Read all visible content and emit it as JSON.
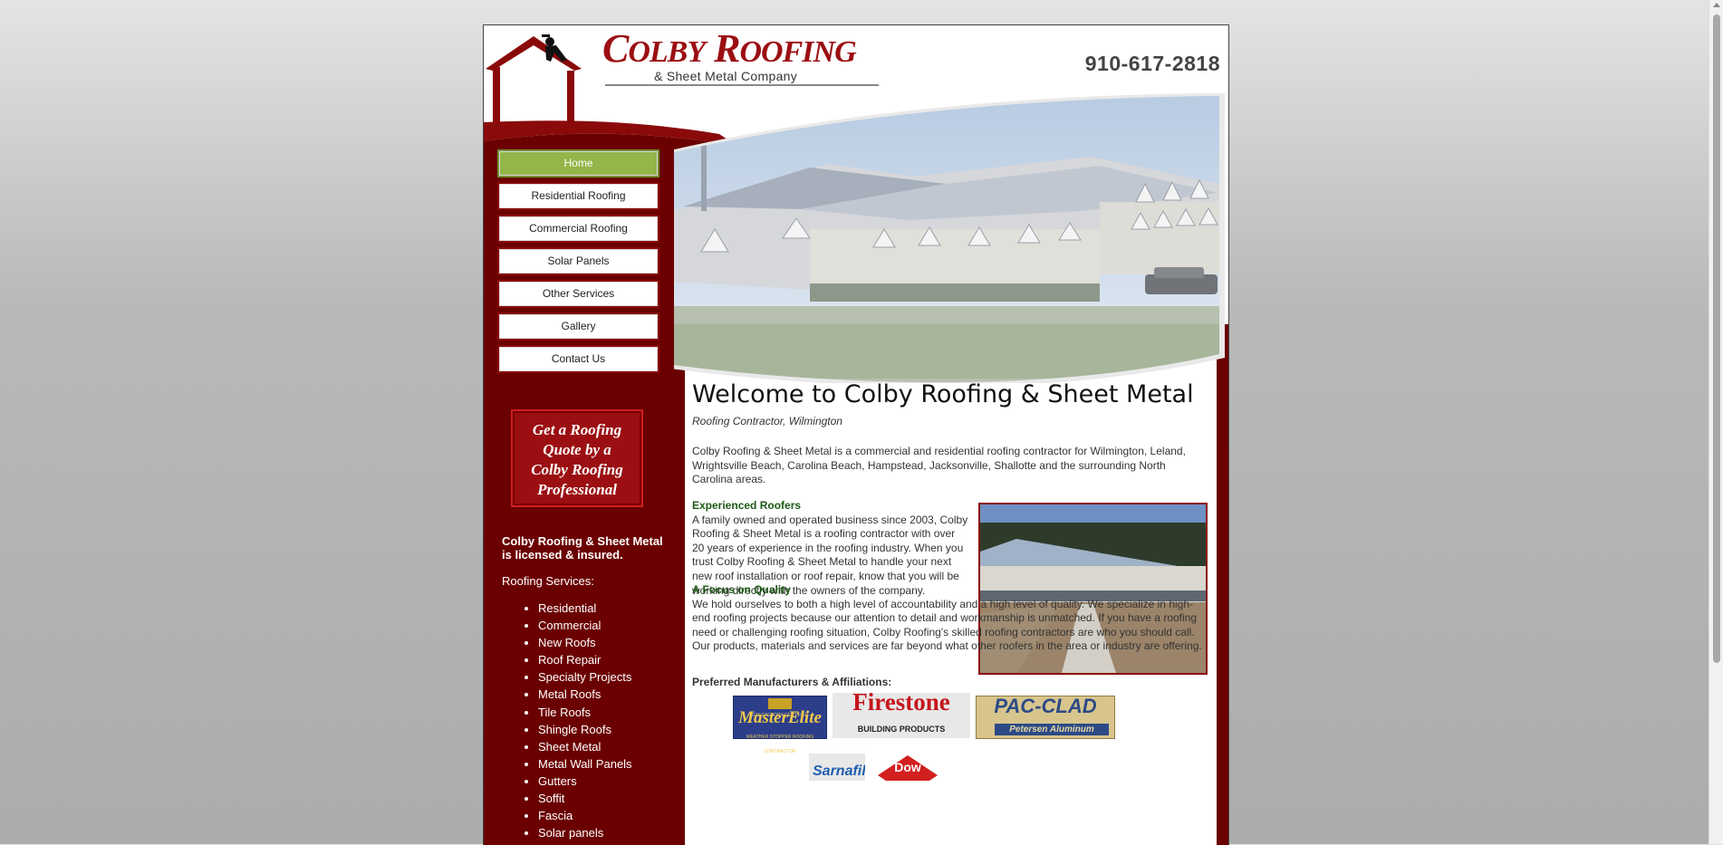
{
  "header": {
    "logo_title_c": "C",
    "logo_title_olby": "OLBY",
    "logo_title_r": "R",
    "logo_title_oofing": "OOFING",
    "logo_subtitle": "& Sheet Metal Company",
    "phone": "910-617-2818"
  },
  "nav": {
    "items": [
      {
        "label": "Home",
        "active": true
      },
      {
        "label": "Residential Roofing"
      },
      {
        "label": "Commercial Roofing"
      },
      {
        "label": "Solar Panels"
      },
      {
        "label": "Other Services"
      },
      {
        "label": "Gallery"
      },
      {
        "label": "Contact Us"
      }
    ]
  },
  "sidebar": {
    "quote_lines": [
      "Get a Roofing",
      "Quote by a",
      "Colby Roofing",
      "Professional"
    ],
    "licensed": "Colby Roofing & Sheet Metal is licensed & insured.",
    "services_heading": "Roofing Services:",
    "services": [
      "Residential",
      "Commercial",
      "New Roofs",
      "Roof Repair",
      "Specialty Projects",
      "Metal Roofs",
      "Tile Roofs",
      "Shingle Roofs",
      "Sheet Metal",
      "Metal Wall Panels",
      "Gutters",
      "Soffit",
      "Fascia",
      "Solar panels"
    ]
  },
  "main": {
    "title": "Welcome to Colby Roofing & Sheet Metal",
    "subtitle": "Roofing Contractor, Wilmington",
    "intro": "Colby Roofing & Sheet Metal is a commercial and residential roofing contractor for Wilmington, Leland, Wrightsville Beach, Carolina Beach, Hampstead, Jacksonville, Shallotte and the surrounding North Carolina areas.",
    "experienced_heading": "Experienced Roofers",
    "experienced_text": "A family owned and operated business since 2003, Colby Roofing & Sheet Metal is a roofing contractor with over 20 years of experience in the roofing industry. When you trust Colby Roofing & Sheet Metal to handle your next new roof installation or roof repair, know that you will be working directly with the owners of the company.",
    "focus_heading": "A Focus on Quality",
    "focus_text": "We hold ourselves to both a high level of accountability and a high level of quality. We specialize in high-end roofing projects because our attention to detail and workmanship is unmatched. If you have a roofing need or challenging roofing situation, Colby Roofing's skilled roofing contractors are who you should call. Our products, materials and services are far beyond what other roofers in the area or industry are offering.",
    "preferred_heading": "Preferred Manufacturers & Affiliations:"
  },
  "logos": {
    "masterelite_small": "GAF FACTORY CERTIFIED",
    "masterelite": "MasterElite",
    "masterelite_tag": "WEATHER STOPPER ROOFING CONTRACTOR",
    "firestone": "Firestone",
    "firestone_sub": "BUILDING PRODUCTS",
    "pacclad": "PAC-CLAD",
    "pacclad_sub": "Petersen Aluminum",
    "sarnafil": "Sarnafil",
    "dow": "Dow"
  },
  "colors": {
    "brand_red": "#9b0f12",
    "dark_red": "#6b0000",
    "nav_active": "#93b549",
    "heading_green": "#1c5a15"
  }
}
